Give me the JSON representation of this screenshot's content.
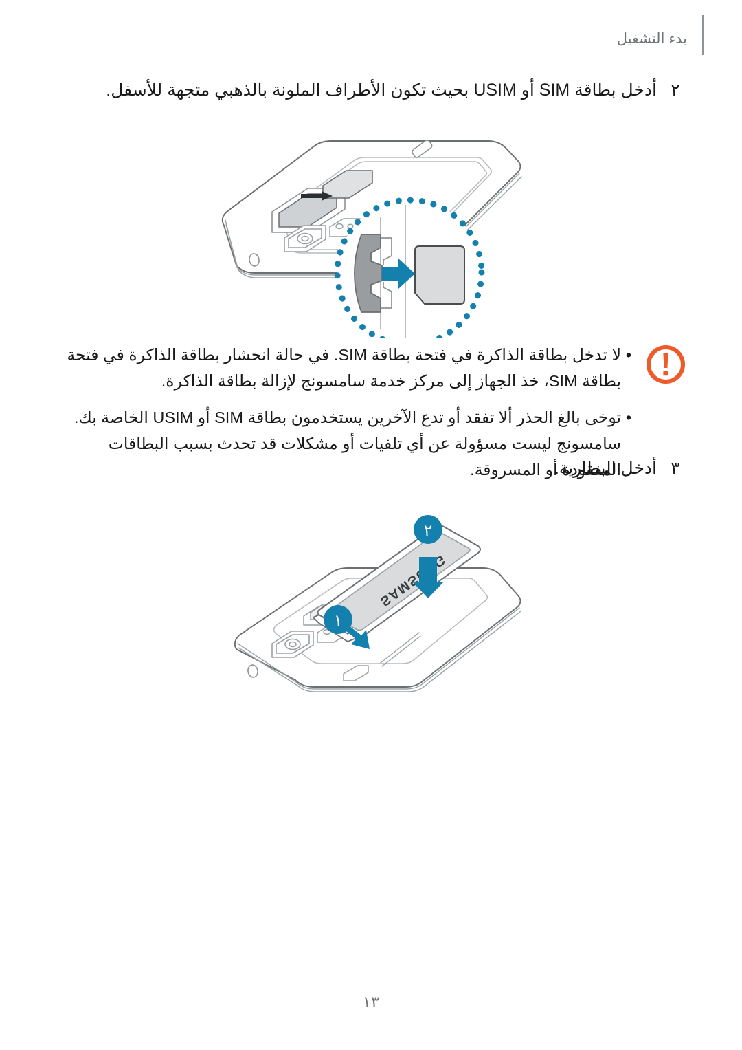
{
  "header": {
    "title": "بدء التشغيل",
    "rule_color": "#8d9396"
  },
  "steps": [
    {
      "number": "٢",
      "text": "أدخل بطاقة SIM أو USIM بحيث تكون الأطراف الملونة بالذهبي متجهة للأسفل."
    },
    {
      "number": "٣",
      "text": "أدخل البطارية."
    }
  ],
  "notice": {
    "icon": "warning-exclamation-icon",
    "icon_color": "#ef5a29",
    "bullet": "•",
    "items": [
      "لا تدخل بطاقة الذاكرة في فتحة بطاقة SIM. في حالة انحشار بطاقة الذاكرة في فتحة بطاقة SIM، خذ الجهاز إلى مركز خدمة سامسونج لإزالة بطاقة الذاكرة.",
      "توخى بالغ الحذر ألا تفقد أو تدع الآخرين يستخدمون بطاقة SIM أو USIM الخاصة بك. سامسونج ليست مسؤولة عن أي تلفيات أو مشكلات قد تحدث بسبب البطاقات المفقودة أو المسروقة."
    ]
  },
  "figures": {
    "sim": {
      "name": "sim-card-insertion-diagram",
      "accent_color": "#1380ae",
      "callout_circle_color": "#1380ae",
      "card_fill": "#d9dbdc",
      "outline_color": "#6b6f72",
      "tray_fill": "#9a9da0"
    },
    "battery": {
      "name": "battery-insertion-diagram",
      "accent_color": "#1380ae",
      "badge_1": "١",
      "badge_2": "٢",
      "battery_brand": "SAMSUNG",
      "battery_fill": "#d9dbdc",
      "outline_color": "#6b6f72"
    }
  },
  "page_number": "١٣"
}
